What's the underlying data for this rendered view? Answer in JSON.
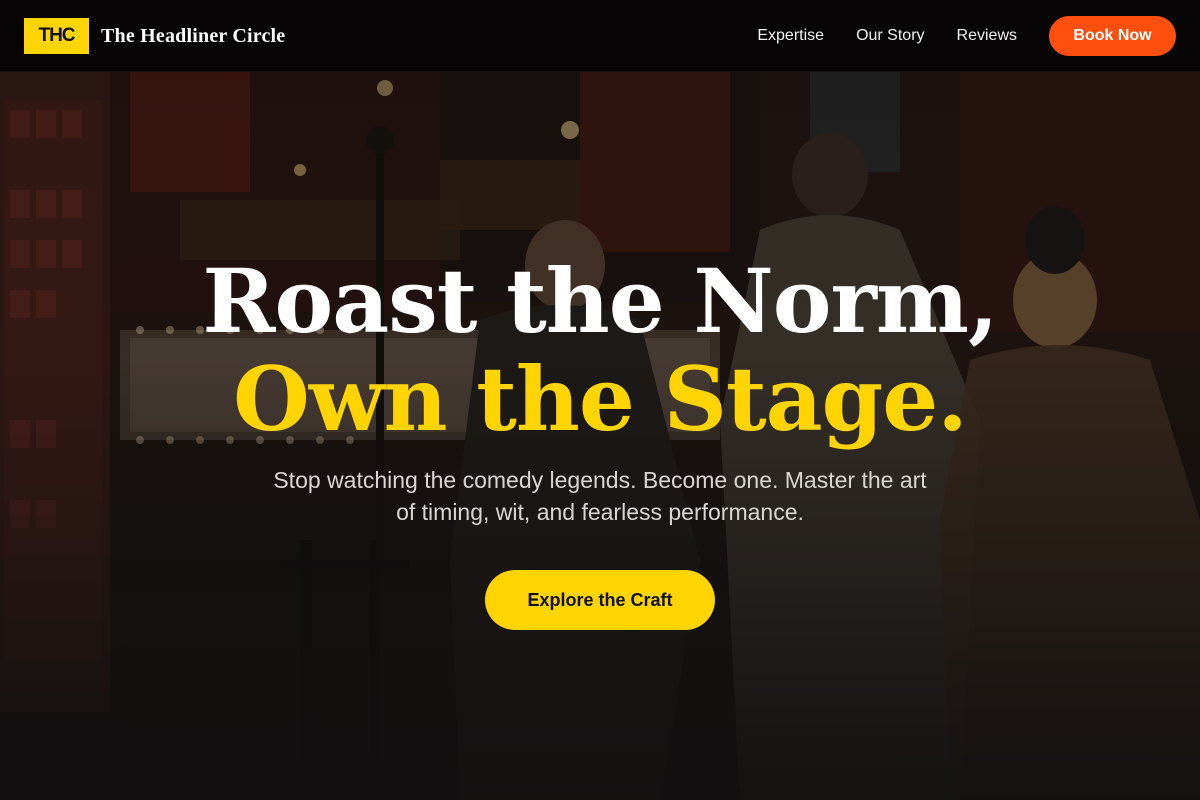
{
  "header": {
    "logo_text": "THC",
    "brand_name": "The Headliner Circle",
    "nav": [
      {
        "label": "Expertise"
      },
      {
        "label": "Our Story"
      },
      {
        "label": "Reviews"
      }
    ],
    "cta_label": "Book Now"
  },
  "hero": {
    "headline_line1": "Roast the Norm,",
    "headline_line2": "Own the Stage.",
    "subtitle": "Stop watching the comedy legends. Become one. Master the art of timing, wit, and fearless performance.",
    "cta_label": "Explore the Craft",
    "background": "comedy club entrance photo"
  },
  "colors": {
    "accent_yellow": "#ffd400",
    "accent_orange": "#ff4f0f",
    "header_bg": "#050404",
    "text_white": "#ffffff"
  }
}
